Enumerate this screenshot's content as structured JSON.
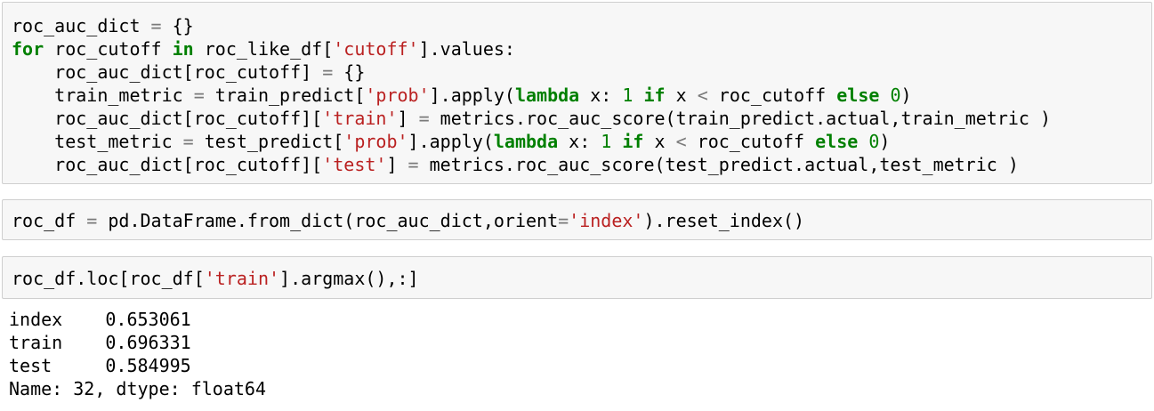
{
  "cells": [
    {
      "lines": [
        [
          {
            "t": "roc_auc_dict "
          },
          {
            "t": "=",
            "c": "op"
          },
          {
            "t": " {}"
          }
        ],
        [
          {
            "t": "for",
            "c": "kw"
          },
          {
            "t": " roc_cutoff "
          },
          {
            "t": "in",
            "c": "kw"
          },
          {
            "t": " roc_like_df["
          },
          {
            "t": "'cutoff'",
            "c": "str"
          },
          {
            "t": "].values:"
          }
        ],
        [
          {
            "t": "    roc_auc_dict[roc_cutoff] "
          },
          {
            "t": "=",
            "c": "op"
          },
          {
            "t": " {}"
          }
        ],
        [
          {
            "t": "    train_metric "
          },
          {
            "t": "=",
            "c": "op"
          },
          {
            "t": " train_predict["
          },
          {
            "t": "'prob'",
            "c": "str"
          },
          {
            "t": "].apply("
          },
          {
            "t": "lambda",
            "c": "kw"
          },
          {
            "t": " x: "
          },
          {
            "t": "1",
            "c": "num"
          },
          {
            "t": " "
          },
          {
            "t": "if",
            "c": "kw"
          },
          {
            "t": " x "
          },
          {
            "t": "<",
            "c": "op"
          },
          {
            "t": " roc_cutoff "
          },
          {
            "t": "else",
            "c": "kw"
          },
          {
            "t": " "
          },
          {
            "t": "0",
            "c": "num"
          },
          {
            "t": ")"
          }
        ],
        [
          {
            "t": "    roc_auc_dict[roc_cutoff]["
          },
          {
            "t": "'train'",
            "c": "str"
          },
          {
            "t": "] "
          },
          {
            "t": "=",
            "c": "op"
          },
          {
            "t": " metrics.roc_auc_score(train_predict.actual,train_metric )"
          }
        ],
        [
          {
            "t": "    test_metric "
          },
          {
            "t": "=",
            "c": "op"
          },
          {
            "t": " test_predict["
          },
          {
            "t": "'prob'",
            "c": "str"
          },
          {
            "t": "].apply("
          },
          {
            "t": "lambda",
            "c": "kw"
          },
          {
            "t": " x: "
          },
          {
            "t": "1",
            "c": "num"
          },
          {
            "t": " "
          },
          {
            "t": "if",
            "c": "kw"
          },
          {
            "t": " x "
          },
          {
            "t": "<",
            "c": "op"
          },
          {
            "t": " roc_cutoff "
          },
          {
            "t": "else",
            "c": "kw"
          },
          {
            "t": " "
          },
          {
            "t": "0",
            "c": "num"
          },
          {
            "t": ")"
          }
        ],
        [
          {
            "t": "    roc_auc_dict[roc_cutoff]["
          },
          {
            "t": "'test'",
            "c": "str"
          },
          {
            "t": "] "
          },
          {
            "t": "=",
            "c": "op"
          },
          {
            "t": " metrics.roc_auc_score(test_predict.actual,test_metric )"
          }
        ]
      ]
    },
    {
      "lines": [
        [
          {
            "t": "roc_df "
          },
          {
            "t": "=",
            "c": "op"
          },
          {
            "t": " pd.DataFrame.from_dict(roc_auc_dict,orient"
          },
          {
            "t": "=",
            "c": "op"
          },
          {
            "t": "'index'",
            "c": "str"
          },
          {
            "t": ").reset_index()"
          }
        ]
      ]
    },
    {
      "lines": [
        [
          {
            "t": "roc_df.loc[roc_df["
          },
          {
            "t": "'train'",
            "c": "str"
          },
          {
            "t": "].argmax(),:]"
          }
        ]
      ]
    }
  ],
  "output": {
    "lines": [
      "index    0.653061",
      "train    0.696331",
      "test     0.584995",
      "Name: 32, dtype: float64"
    ]
  }
}
